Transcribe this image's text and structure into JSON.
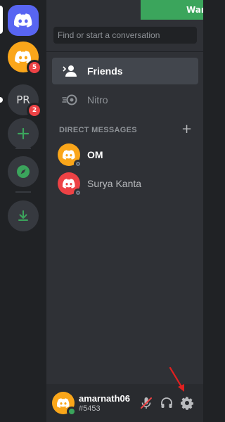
{
  "banner": {
    "text": "Wan"
  },
  "servers": {
    "dm_badge": "5",
    "pr_label": "PR",
    "pr_badge": "2"
  },
  "search": {
    "placeholder": "Find or start a conversation"
  },
  "nav": {
    "friends_label": "Friends",
    "nitro_label": "Nitro"
  },
  "direct_messages": {
    "header": "DIRECT MESSAGES",
    "add_icon": "plus-icon",
    "items": [
      {
        "name": "OM",
        "status": "offline",
        "avatar_color": "#faa61a"
      },
      {
        "name": "Surya Kanta",
        "status": "offline",
        "avatar_color": "#ed4245"
      }
    ]
  },
  "user": {
    "username": "amarnath06",
    "tag": "#5453",
    "status": "online"
  },
  "colors": {
    "blurple": "#5865f2",
    "green": "#3ba55c",
    "red": "#ed4245",
    "yellow": "#faa61a",
    "arrow": "#e02020"
  }
}
